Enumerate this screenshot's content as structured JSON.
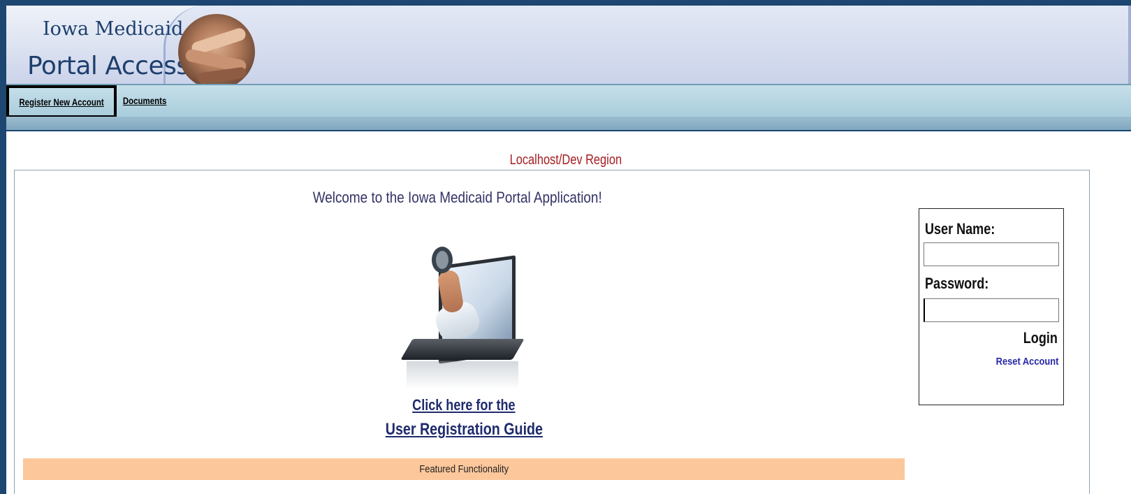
{
  "header": {
    "logo_line1": "Iowa Medicaid",
    "logo_line2": "Portal Access"
  },
  "nav": {
    "register_label": "Register New Account",
    "documents_label": "Documents"
  },
  "region_label": "Localhost/Dev Region",
  "main": {
    "welcome": "Welcome to the Iowa Medicaid Portal Application!",
    "guide_line1": "Click here for the",
    "guide_line2": "User Registration Guide",
    "featured_label": "Featured Functionality"
  },
  "login": {
    "username_label": "User Name:",
    "password_label": "Password:",
    "username_value": "",
    "password_value": "",
    "login_label": "Login",
    "reset_label": "Reset Account"
  },
  "colors": {
    "frame": "#1d4670",
    "region_text": "#a61e22",
    "link": "#1f2b6e",
    "featured_bg": "#fcc79b"
  }
}
